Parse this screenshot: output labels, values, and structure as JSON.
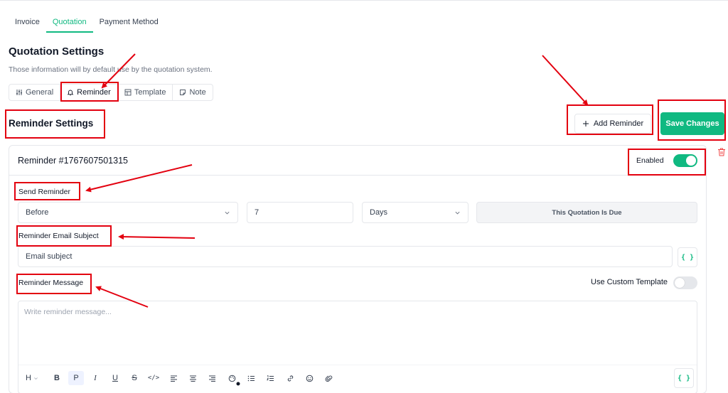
{
  "top_tabs": [
    {
      "label": "Invoice"
    },
    {
      "label": "Quotation",
      "active": true
    },
    {
      "label": "Payment Method"
    }
  ],
  "page": {
    "title": "Quotation Settings",
    "subtitle": "Those information will by default use by the quotation system."
  },
  "sub_tabs": [
    {
      "label": "General",
      "icon": "sliders-icon"
    },
    {
      "label": "Reminder",
      "icon": "bell-icon",
      "active": true
    },
    {
      "label": "Template",
      "icon": "template-icon"
    },
    {
      "label": "Note",
      "icon": "note-icon"
    }
  ],
  "section": {
    "title": "Reminder Settings"
  },
  "actions": {
    "add_reminder": "Add Reminder",
    "save": "Save Changes"
  },
  "reminder": {
    "title": "Reminder #1767607501315",
    "enabled_label": "Enabled",
    "enabled": true,
    "send_label": "Send Reminder",
    "timing": "Before",
    "amount": "7",
    "unit": "Days",
    "event": "This Quotation Is Due",
    "subject_label": "Reminder Email Subject",
    "subject_value": "Email subject",
    "message_label": "Reminder Message",
    "custom_template_label": "Use Custom Template",
    "custom_template": false,
    "message_placeholder": "Write reminder message...",
    "variable_button": "{ }"
  },
  "toolbar": [
    {
      "label": "H",
      "name": "heading-button"
    },
    {
      "label": "B",
      "name": "bold-button"
    },
    {
      "label": "P",
      "name": "paragraph-button"
    },
    {
      "label": "I",
      "name": "italic-button"
    },
    {
      "label": "U",
      "name": "underline-button"
    },
    {
      "label": "S",
      "name": "strikethrough-button"
    },
    {
      "label": "</>",
      "name": "code-button"
    }
  ],
  "colors": {
    "accent": "#10b981",
    "annotation": "#e3000f"
  }
}
